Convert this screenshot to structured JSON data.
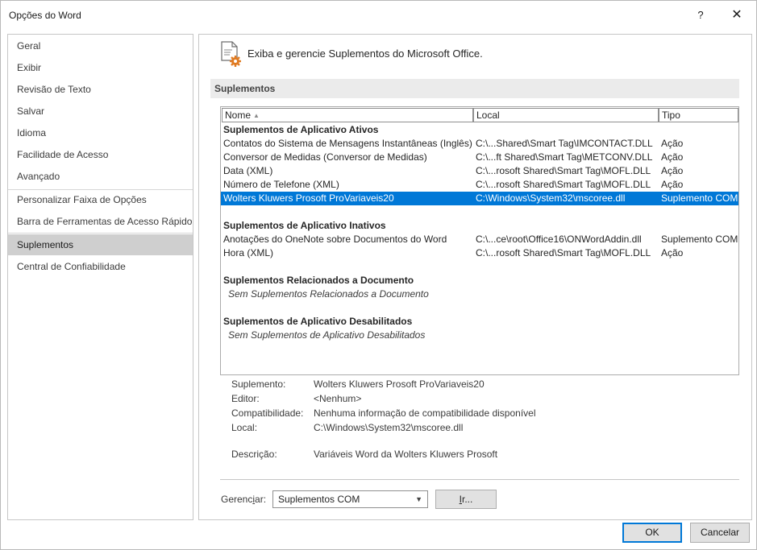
{
  "window": {
    "title": "Opções do Word",
    "help_glyph": "?",
    "close_glyph": "✕"
  },
  "nav": {
    "items": [
      {
        "label": "Geral"
      },
      {
        "label": "Exibir"
      },
      {
        "label": "Revisão de Texto"
      },
      {
        "label": "Salvar"
      },
      {
        "label": "Idioma"
      },
      {
        "label": "Facilidade de Acesso"
      },
      {
        "label": "Avançado"
      },
      {
        "label": "Personalizar Faixa de Opções"
      },
      {
        "label": "Barra de Ferramentas de Acesso Rápido"
      },
      {
        "label": "Suplementos"
      },
      {
        "label": "Central de Confiabilidade"
      }
    ],
    "selected": "Suplementos"
  },
  "header": {
    "text": "Exiba e gerencie Suplementos do Microsoft Office.",
    "icon": "addins-gear-icon"
  },
  "section": {
    "title": "Suplementos"
  },
  "table": {
    "columns": {
      "name": "Nome",
      "location": "Local",
      "type": "Tipo"
    },
    "groups": [
      {
        "title": "Suplementos de Aplicativo Ativos",
        "rows": [
          {
            "name": "Contatos do Sistema de Mensagens Instantâneas (Inglês)",
            "location": "C:\\...Shared\\Smart Tag\\IMCONTACT.DLL",
            "type": "Ação"
          },
          {
            "name": "Conversor de Medidas (Conversor de Medidas)",
            "location": "C:\\...ft Shared\\Smart Tag\\METCONV.DLL",
            "type": "Ação"
          },
          {
            "name": "Data (XML)",
            "location": "C:\\...rosoft Shared\\Smart Tag\\MOFL.DLL",
            "type": "Ação"
          },
          {
            "name": "Número de Telefone (XML)",
            "location": "C:\\...rosoft Shared\\Smart Tag\\MOFL.DLL",
            "type": "Ação"
          },
          {
            "name": "Wolters Kluwers Prosoft ProVariaveis20",
            "location": "C:\\Windows\\System32\\mscoree.dll",
            "type": "Suplemento COM"
          }
        ]
      },
      {
        "title": "Suplementos de Aplicativo Inativos",
        "rows": [
          {
            "name": "Anotações do OneNote sobre Documentos do Word",
            "location": "C:\\...ce\\root\\Office16\\ONWordAddin.dll",
            "type": "Suplemento COM"
          },
          {
            "name": "Hora (XML)",
            "location": "C:\\...rosoft Shared\\Smart Tag\\MOFL.DLL",
            "type": "Ação"
          }
        ]
      },
      {
        "title": "Suplementos Relacionados a Documento",
        "empty": "Sem Suplementos Relacionados a Documento"
      },
      {
        "title": "Suplementos de Aplicativo Desabilitados",
        "empty": "Sem Suplementos de Aplicativo Desabilitados"
      }
    ]
  },
  "details": {
    "addin_label": "Suplemento:",
    "addin_value": "Wolters Kluwers Prosoft ProVariaveis20",
    "publisher_label": "Editor:",
    "publisher_value": "<Nenhum>",
    "compat_label": "Compatibilidade:",
    "compat_value": "Nenhuma informação de compatibilidade disponível",
    "location_label": "Local:",
    "location_value": "C:\\Windows\\System32\\mscoree.dll",
    "description_label": "Descrição:",
    "description_value": "Variáveis Word da Wolters Kluwers Prosoft"
  },
  "manage": {
    "label_pre": "Gerenc",
    "label_key": "i",
    "label_post": "ar:",
    "selected": "Suplementos COM",
    "go_key": "I",
    "go_post": "r..."
  },
  "buttons": {
    "ok": "OK",
    "cancel": "Cancelar"
  },
  "colors": {
    "selection": "#0078d7",
    "nav_selected": "#cfcfcf",
    "section_bar": "#ebebeb"
  }
}
